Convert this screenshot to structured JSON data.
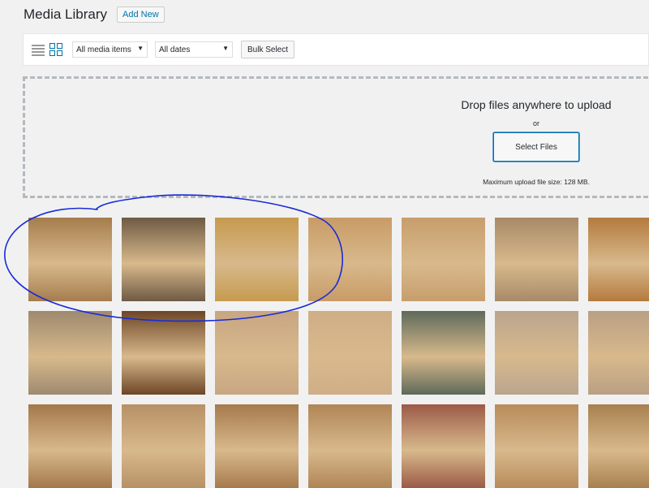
{
  "header": {
    "title": "Media Library",
    "add_new_label": "Add New"
  },
  "toolbar": {
    "filter_type": "All media items",
    "filter_date": "All dates",
    "bulk_select_label": "Bulk Select"
  },
  "uploader": {
    "drop_text": "Drop files anywhere to upload",
    "or_text": "or",
    "select_files_label": "Select Files",
    "max_size_text": "Maximum upload file size: 128 MB."
  },
  "icons": {
    "list_view": "list-view-icon",
    "grid_view": "grid-view-icon",
    "dropdown": "chevron-down-icon"
  },
  "colors": {
    "accent": "#0073aa",
    "background": "#f1f1f1",
    "annotation": "#1a2bd8"
  },
  "media_items": [
    {
      "alt": "Grill table with green egg grill",
      "bg": "#a57d4d"
    },
    {
      "alt": "Deck with green egg on cart",
      "bg": "#6e5a44"
    },
    {
      "alt": "Green egg in wooden table",
      "bg": "#c69a4f"
    },
    {
      "alt": "Wooden grill table top",
      "bg": "#c89b66"
    },
    {
      "alt": "Wooden grill table side",
      "bg": "#c79e6c"
    },
    {
      "alt": "Green egg on wooden cart",
      "bg": "#a88a68"
    },
    {
      "alt": "Wooden table with cutout",
      "bg": "#b47a3e"
    },
    {
      "alt": "Small wooden egg stand",
      "bg": "#9e8a6f"
    },
    {
      "alt": "Dark wood cabinet",
      "bg": "#6e4627"
    },
    {
      "alt": "Open cabinet doors",
      "bg": "#c7a682"
    },
    {
      "alt": "Wooden cabinet with latches",
      "bg": "#cfae86"
    },
    {
      "alt": "Green egg on table outdoors",
      "bg": "#5e6a5a"
    },
    {
      "alt": "Wooden table cabinet set",
      "bg": "#b9a58e"
    },
    {
      "alt": "Wooden table drawers",
      "bg": "#b9a084"
    },
    {
      "alt": "Wooden table top view",
      "bg": "#a3784b"
    },
    {
      "alt": "Wooden table frame",
      "bg": "#b89066"
    },
    {
      "alt": "Wooden table panels",
      "bg": "#a67a4c"
    },
    {
      "alt": "Wooden table edge",
      "bg": "#b08556"
    },
    {
      "alt": "Red egg grill",
      "bg": "#9b5a47"
    },
    {
      "alt": "Wooden bench",
      "bg": "#b88b5a"
    },
    {
      "alt": "Wooden table corner",
      "bg": "#a8804f"
    }
  ]
}
